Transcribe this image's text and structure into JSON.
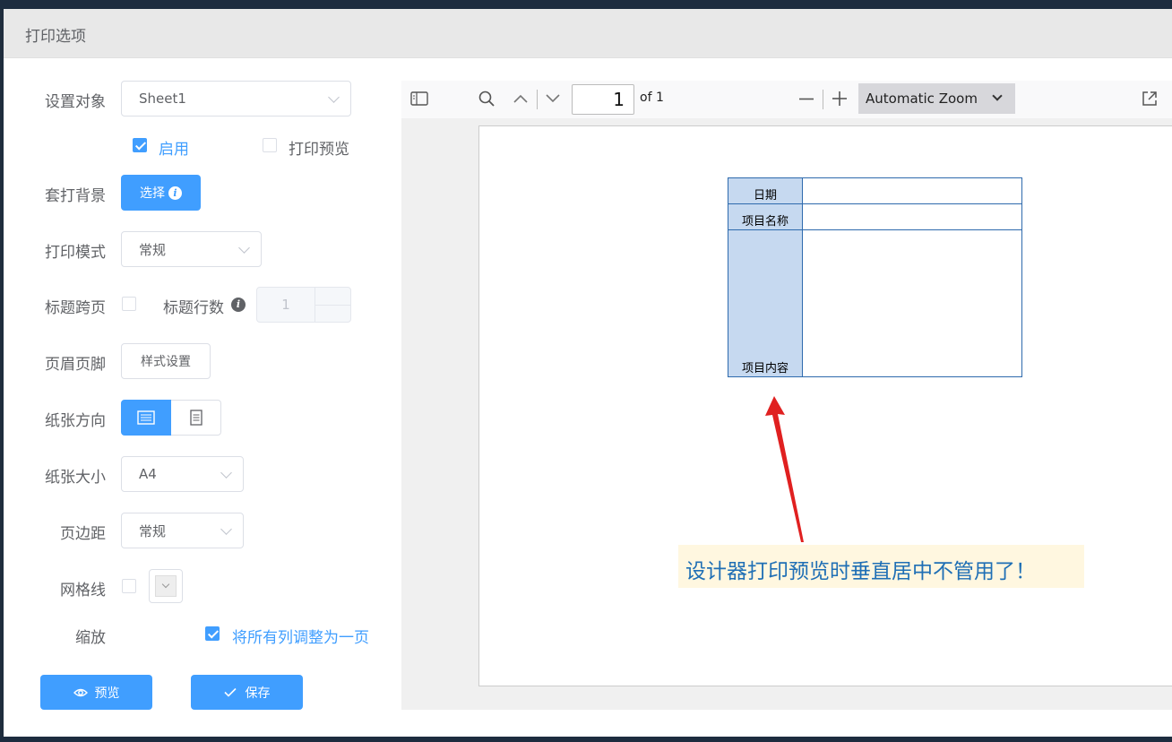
{
  "dialog": {
    "title": "打印选项"
  },
  "form": {
    "target_label": "设置对象",
    "target_value": "Sheet1",
    "enable_label": "启用",
    "enable_checked": true,
    "print_preview_label": "打印预览",
    "print_preview_checked": false,
    "background_label": "套打背景",
    "background_button": "选择",
    "mode_label": "打印模式",
    "mode_value": "常规",
    "title_span_label": "标题跨页",
    "title_span_checked": false,
    "title_rows_label": "标题行数",
    "title_rows_value": "1",
    "header_footer_label": "页眉页脚",
    "style_button": "样式设置",
    "orientation_label": "纸张方向",
    "orientation_selected": "landscape",
    "size_label": "纸张大小",
    "size_value": "A4",
    "margin_label": "页边距",
    "margin_value": "常规",
    "gridline_label": "网格线",
    "gridline_checked": false,
    "scale_label": "缩放",
    "fit_columns_label": "将所有列调整为一页",
    "fit_columns_checked": true,
    "preview_button": "预览",
    "save_button": "保存"
  },
  "viewer": {
    "page_number": "1",
    "page_total": "of 1",
    "zoom": "Automatic Zoom",
    "sheet_rows": [
      {
        "label": "日期",
        "value": ""
      },
      {
        "label": "项目名称",
        "value": ""
      },
      {
        "label": "项目内容",
        "value": ""
      }
    ]
  },
  "annotation": {
    "text": "设计器打印预览时垂直居中不管用了！",
    "color": "#e02020"
  },
  "colors": {
    "primary": "#409eff",
    "header_bg": "#e8e8e8",
    "sheet_label_bg": "#c6d9f0",
    "sheet_border": "#2e6aad",
    "note_bg": "#fff7e0",
    "note_text": "#1f6fb5"
  }
}
